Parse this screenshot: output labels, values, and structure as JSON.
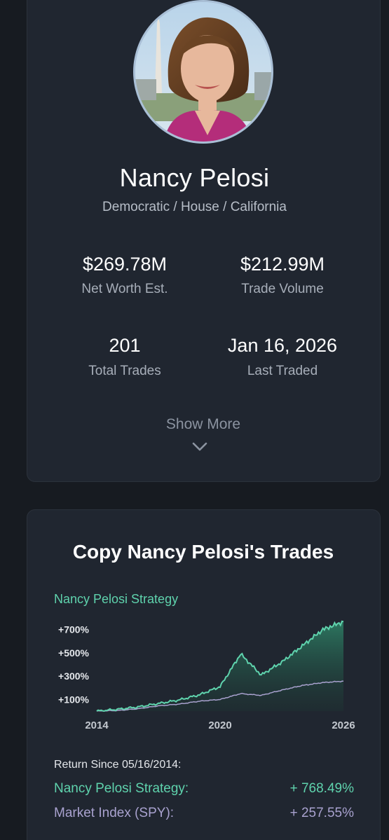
{
  "profile": {
    "name": "Nancy Pelosi",
    "subtitle": "Democratic / House / California",
    "stats": [
      {
        "value": "$269.78M",
        "label": "Net Worth Est."
      },
      {
        "value": "$212.99M",
        "label": "Trade Volume"
      },
      {
        "value": "201",
        "label": "Total Trades"
      },
      {
        "value": "Jan 16, 2026",
        "label": "Last Traded"
      }
    ],
    "show_more": "Show More"
  },
  "copy": {
    "title": "Copy Nancy Pelosi's Trades",
    "strategy_label": "Nancy Pelosi Strategy",
    "return_since": "Return Since 05/16/2014:",
    "returns": [
      {
        "name": "Nancy Pelosi Strategy:",
        "value": "+ 768.49%"
      },
      {
        "name": "Market Index (SPY):",
        "value": "+ 257.55%"
      }
    ]
  },
  "chart_data": {
    "type": "area",
    "x_ticks": [
      "2014",
      "2020",
      "2026"
    ],
    "y_ticks": [
      "+700%",
      "+500%",
      "+300%",
      "+100%"
    ],
    "x": [
      "2014",
      "2015",
      "2016",
      "2017",
      "2018",
      "2019",
      "2020",
      "2021",
      "2022",
      "2023",
      "2024",
      "2025",
      "2026"
    ],
    "series": [
      {
        "name": "Nancy Pelosi Strategy",
        "color": "#5fd3ad",
        "values": [
          0,
          15,
          35,
          65,
          95,
          140,
          210,
          490,
          310,
          420,
          560,
          700,
          768
        ]
      },
      {
        "name": "Market Index (SPY)",
        "color": "#a9a2cf",
        "values": [
          0,
          5,
          20,
          45,
          60,
          85,
          100,
          150,
          135,
          180,
          220,
          245,
          257
        ]
      }
    ]
  },
  "colors": {
    "background": "#171b21",
    "card": "#202630",
    "strategy": "#5fd3ad",
    "index": "#a9a2cf"
  }
}
